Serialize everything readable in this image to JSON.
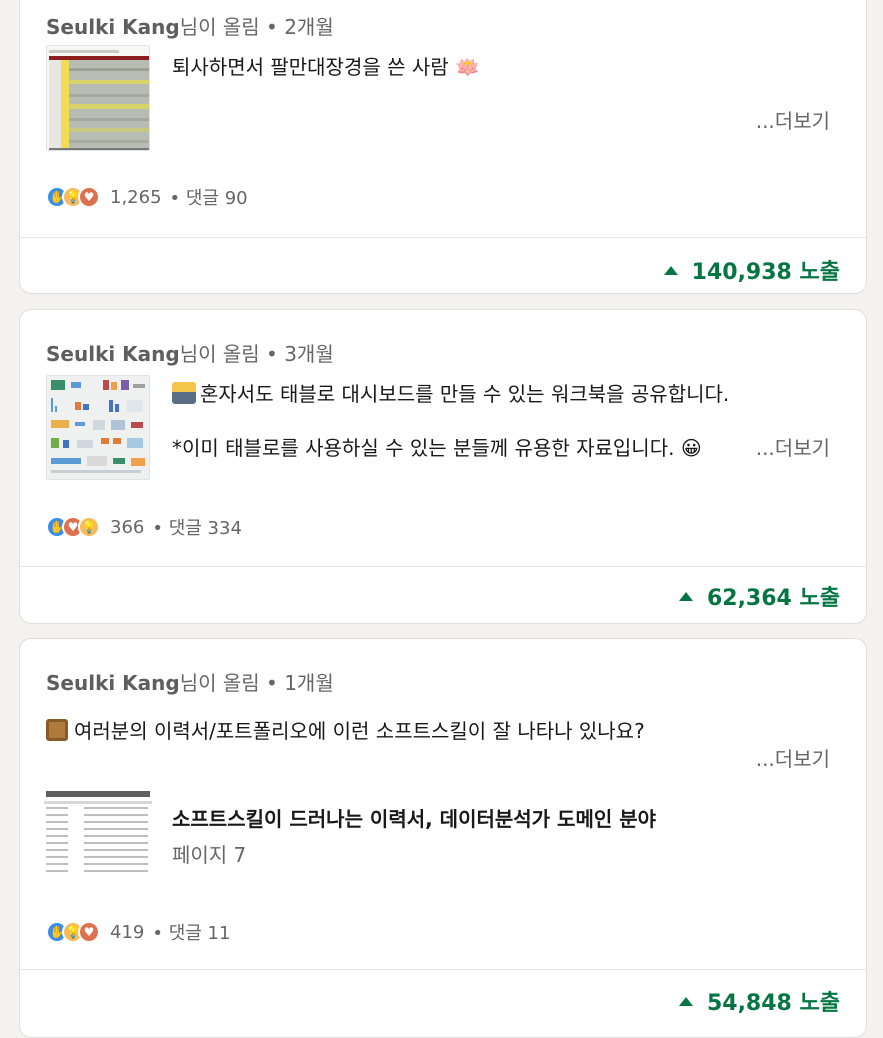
{
  "posts": [
    {
      "author": "Seulki Kang",
      "posted_suffix": "님이 올림 • 2개월",
      "text_lines": [
        "퇴사하면서 팔만대장경을 쓴 사람 🪷"
      ],
      "more": "...더보기",
      "reactions_count": "1,265",
      "comments": "• 댓글 90",
      "impressions": "140,938 노출"
    },
    {
      "author": "Seulki Kang",
      "posted_suffix": "님이 올림 • 3개월",
      "text_lines": [
        "혼자서도 태블로 대시보드를 만들 수 있는 워크북을 공유합니다.",
        "*이미 태블로를 사용하실 수 있는 분들께 유용한 자료입니다. 😀"
      ],
      "more": "...더보기",
      "reactions_count": "366",
      "comments": "• 댓글 334",
      "impressions": "62,364 노출"
    },
    {
      "author": "Seulki Kang",
      "posted_suffix": "님이 올림 • 1개월",
      "text_lines": [
        "여러분의 이력서/포트폴리오에 이런 소프트스킬이 잘 나타나 있나요?"
      ],
      "more": "...더보기",
      "doc_title": "소프트스킬이 드러나는 이력서, 데이터분석가 도메인 분야",
      "doc_pages": "페이지 7",
      "reactions_count": "419",
      "comments": "• 댓글 11",
      "impressions": "54,848 노출"
    }
  ],
  "colors": {
    "impression_green": "#057642",
    "muted": "#666666"
  }
}
